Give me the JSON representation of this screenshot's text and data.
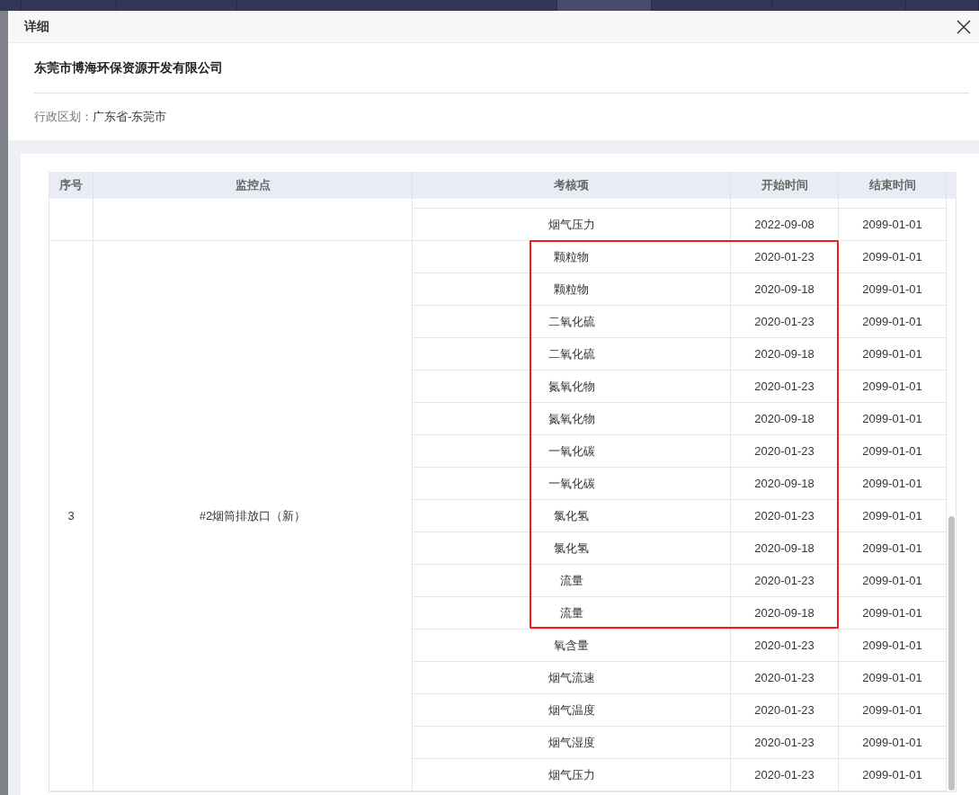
{
  "nav_tabs": [
    {
      "selected": false
    },
    {
      "selected": false
    },
    {
      "selected": false
    },
    {
      "selected": false
    },
    {
      "selected": true
    },
    {
      "selected": false
    },
    {
      "selected": false
    },
    {
      "selected": false
    }
  ],
  "dialog": {
    "title": "详细",
    "company": "东莞市博海环保资源开发有限公司",
    "region_label": "行政区划：",
    "region_value": "广东省-东莞市"
  },
  "table": {
    "columns": [
      "序号",
      "监控点",
      "考核项",
      "开始时间",
      "结束时间"
    ],
    "groups": [
      {
        "items": [
          {
            "item": "烟气压力",
            "start": "2022-09-08",
            "end": "2099-01-01",
            "highlighted": false
          }
        ]
      },
      {
        "serial": "3",
        "point": "#2烟筒排放口（新）",
        "items": [
          {
            "item": "颗粒物",
            "start": "2020-01-23",
            "end": "2099-01-01",
            "highlighted": true
          },
          {
            "item": "颗粒物",
            "start": "2020-09-18",
            "end": "2099-01-01",
            "highlighted": true
          },
          {
            "item": "二氧化硫",
            "start": "2020-01-23",
            "end": "2099-01-01",
            "highlighted": true
          },
          {
            "item": "二氧化硫",
            "start": "2020-09-18",
            "end": "2099-01-01",
            "highlighted": true
          },
          {
            "item": "氮氧化物",
            "start": "2020-01-23",
            "end": "2099-01-01",
            "highlighted": true
          },
          {
            "item": "氮氧化物",
            "start": "2020-09-18",
            "end": "2099-01-01",
            "highlighted": true
          },
          {
            "item": "一氧化碳",
            "start": "2020-01-23",
            "end": "2099-01-01",
            "highlighted": true
          },
          {
            "item": "一氧化碳",
            "start": "2020-09-18",
            "end": "2099-01-01",
            "highlighted": true
          },
          {
            "item": "氯化氢",
            "start": "2020-01-23",
            "end": "2099-01-01",
            "highlighted": true
          },
          {
            "item": "氯化氢",
            "start": "2020-09-18",
            "end": "2099-01-01",
            "highlighted": true
          },
          {
            "item": "流量",
            "start": "2020-01-23",
            "end": "2099-01-01",
            "highlighted": true
          },
          {
            "item": "流量",
            "start": "2020-09-18",
            "end": "2099-01-01",
            "highlighted": true
          },
          {
            "item": "氧含量",
            "start": "2020-01-23",
            "end": "2099-01-01",
            "highlighted": false
          },
          {
            "item": "烟气流速",
            "start": "2020-01-23",
            "end": "2099-01-01",
            "highlighted": false
          },
          {
            "item": "烟气温度",
            "start": "2020-01-23",
            "end": "2099-01-01",
            "highlighted": false
          },
          {
            "item": "烟气湿度",
            "start": "2020-01-23",
            "end": "2099-01-01",
            "highlighted": false
          },
          {
            "item": "烟气压力",
            "start": "2020-01-23",
            "end": "2099-01-01",
            "highlighted": false
          }
        ]
      }
    ]
  }
}
